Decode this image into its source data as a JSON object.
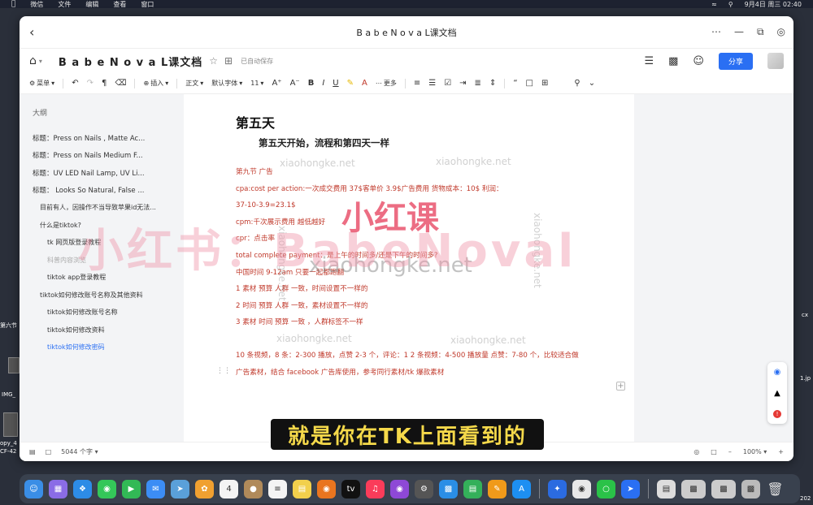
{
  "menubar": {
    "items": [
      "微信",
      "文件",
      "编辑",
      "查看",
      "窗口"
    ],
    "clock": "9月4日 周三  02:40"
  },
  "desktop": {
    "labels": [
      "第六节",
      "IMG_",
      "opy_4",
      "CF-42",
      "cx",
      "1.jp",
      "202"
    ]
  },
  "window": {
    "title": "B a b e N o v a L课文档"
  },
  "docbar": {
    "doc_name": "B a b e N o v a L课文档",
    "saved_status": "已自动保存",
    "share_label": "分享"
  },
  "toolbar": {
    "menu_label": "菜单",
    "insert_label": "插入",
    "style_label": "正文",
    "font_label": "默认字体",
    "size_label": "11",
    "more_label": "更多"
  },
  "outline": {
    "heading": "大纲",
    "items": [
      {
        "level": 1,
        "label": "标题：Press on Nails , Matte Ac..."
      },
      {
        "level": 1,
        "label": "标题：Press on Nails Medium F..."
      },
      {
        "level": 1,
        "label": "标题：UV LED Nail Lamp, UV Li..."
      },
      {
        "level": 1,
        "label": "标题：  Looks So Natural, False ..."
      },
      {
        "level": 2,
        "label": "目前有人，因操作不当导致苹果id无法..."
      },
      {
        "level": 2,
        "label": "什么是tiktok?"
      },
      {
        "level": 3,
        "label": "tk 网页版登录教程"
      },
      {
        "level": 3,
        "label": "科普内容浏览",
        "muted": true
      },
      {
        "level": 3,
        "label": "tiktok app登录教程"
      },
      {
        "level": 2,
        "label": "tiktok如何修改账号名称及其他资料"
      },
      {
        "level": 3,
        "label": "tiktok如何修改账号名称"
      },
      {
        "level": 3,
        "label": "tiktok如何修改资料"
      },
      {
        "level": 3,
        "label": "tiktok如何修改密码",
        "active": true
      }
    ]
  },
  "page": {
    "h1": "第五天",
    "h2": "第五天开始，流程和第四天一样",
    "lines": [
      "第九节 广告",
      "cpa:cost  per  action:一次成交费用    37$客单价  3.9$广告费用  货物成本：10$    利润：",
      "37-10-3.9=23.1$",
      "cpm:千次展示费用   越低越好",
      "cpr：点击率",
      "total  complete  payment：是上午的时间多/还是下午的时间多?",
      "中国时间 9-12am  只要一起都跑翻",
      "1 素材  预算  人群  一致，时间设置不一样的",
      "2 时间  预算  人群  一致，素材设置不一样的",
      "3 素材  时间  预算  一致  ，人群标签不一样"
    ],
    "para": "10 条视频，8 条：2-300 播放，点赞 2-3 个，评论：1    2 条视频：4-500 播放量  点赞：7-80 个，比较适合做广告素材，结合 facebook 广告库使用，参考同行素材/tk 爆款素材"
  },
  "statusbar": {
    "word_count": "5044 个字",
    "zoom": "100%"
  },
  "watermarks": {
    "site": "xiaohongke.net",
    "brand_big": "小红书：BabeNoval",
    "brand_red": "小红课"
  },
  "subtitle": "就是你在TK上面看到的",
  "colors": {
    "accent": "#2a6ff3",
    "body_text": "#c0392b",
    "subtitle_text": "#f5d94a"
  }
}
